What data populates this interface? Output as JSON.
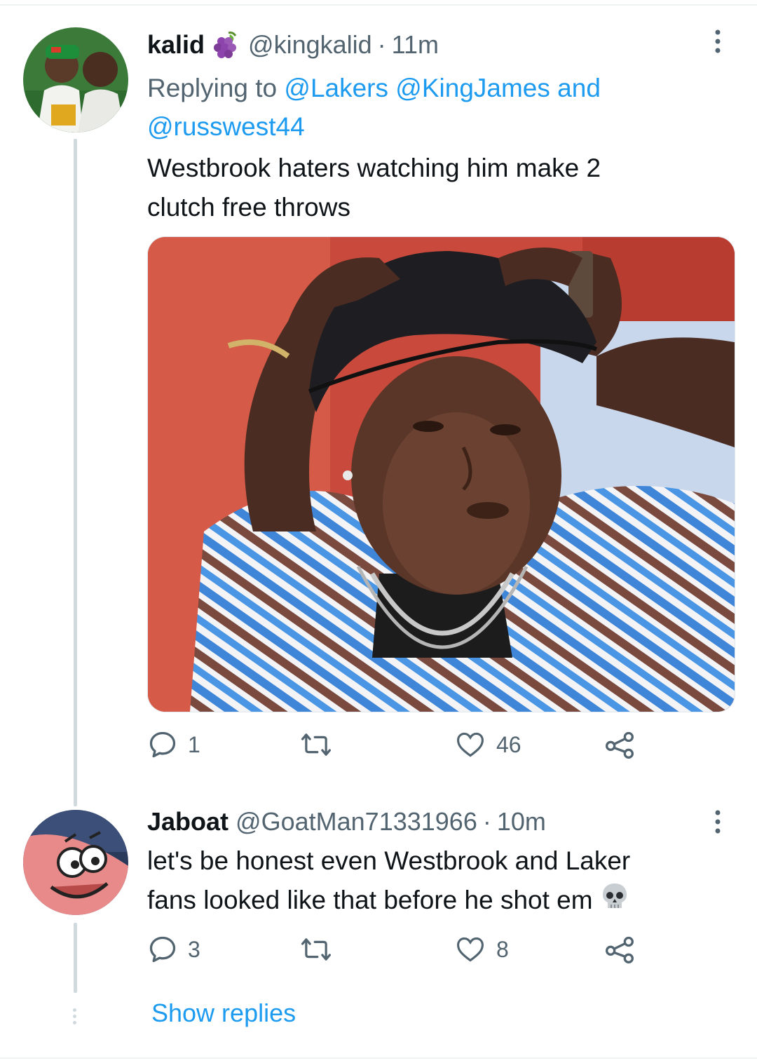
{
  "tweet1": {
    "name": "kalid",
    "handle": "@kingkalid",
    "separator": "·",
    "time": "11m",
    "avatar_icon": "avatar-photo",
    "badge_icon": "grapes-emoji",
    "reply_prefix": "Replying to",
    "mentions": [
      "@Lakers",
      "@KingJames"
    ],
    "reply_and": "and",
    "mention_last": "@russwest44",
    "text_line1": "Westbrook haters watching him make 2",
    "text_line2": "clutch free throws",
    "media_icon": "meme-photo",
    "actions": {
      "reply_count": "1",
      "retweet_count": "",
      "like_count": "46"
    }
  },
  "tweet2": {
    "name": "Jaboat",
    "handle": "@GoatMan71331966",
    "separator": "·",
    "time": "10m",
    "avatar_icon": "cartoon-avatar",
    "text_line1": "let's be honest even Westbrook and Laker",
    "text_line2": "fans looked like that before he shot em",
    "text_emoji": "skull-emoji",
    "actions": {
      "reply_count": "3",
      "retweet_count": "",
      "like_count": "8"
    }
  },
  "show_replies": "Show replies",
  "colors": {
    "accent": "#1d9bf0",
    "text": "#0f1419",
    "secondary": "#536471",
    "thread_line": "#cfd9de"
  }
}
